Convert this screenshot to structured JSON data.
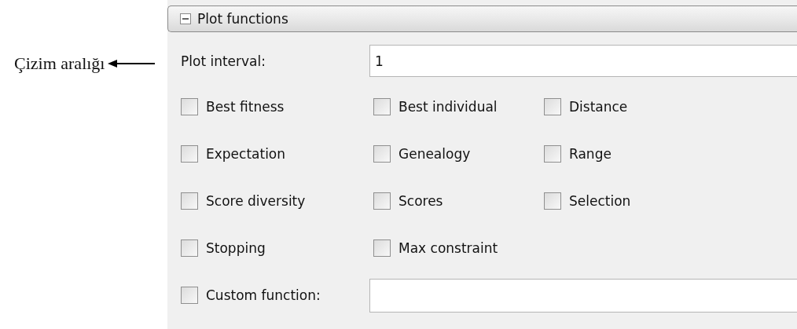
{
  "annotation": {
    "text": "Çizim aralığı"
  },
  "section": {
    "title": "Plot functions",
    "expanded": true
  },
  "plot_interval": {
    "label": "Plot interval:",
    "value": "1"
  },
  "options": [
    [
      {
        "label": "Best fitness",
        "checked": false
      },
      {
        "label": "Best individual",
        "checked": false
      },
      {
        "label": "Distance",
        "checked": false
      }
    ],
    [
      {
        "label": "Expectation",
        "checked": false
      },
      {
        "label": "Genealogy",
        "checked": false
      },
      {
        "label": "Range",
        "checked": false
      }
    ],
    [
      {
        "label": "Score diversity",
        "checked": false
      },
      {
        "label": "Scores",
        "checked": false
      },
      {
        "label": "Selection",
        "checked": false
      }
    ],
    [
      {
        "label": "Stopping",
        "checked": false
      },
      {
        "label": "Max constraint",
        "checked": false
      }
    ]
  ],
  "custom_function": {
    "label": "Custom function:",
    "checked": false
  }
}
